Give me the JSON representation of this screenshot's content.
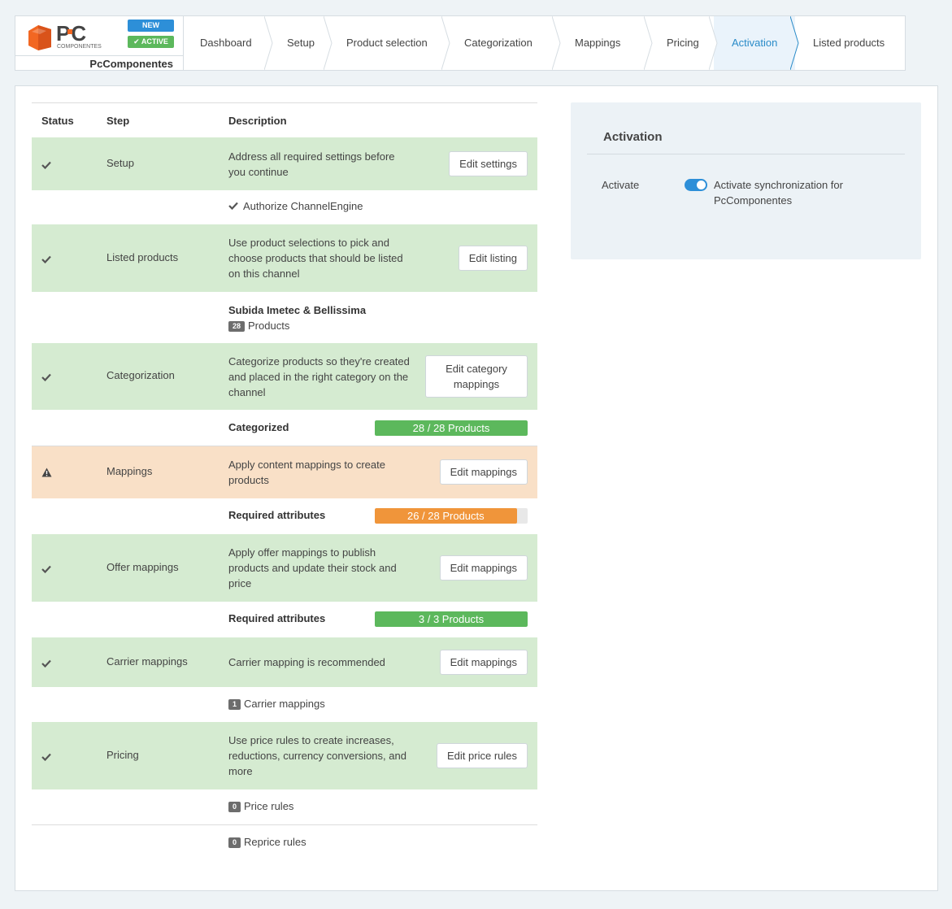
{
  "channel": {
    "name": "PcComponentes",
    "logo_text": "PC",
    "logo_sub": "COMPONENTES",
    "badge_new": "NEW",
    "badge_active": "ACTIVE"
  },
  "nav": {
    "steps": [
      "Dashboard",
      "Setup",
      "Product selection",
      "Categorization",
      "Mappings",
      "Pricing",
      "Activation",
      "Listed products"
    ],
    "active": "Activation"
  },
  "table": {
    "headers": {
      "status": "Status",
      "step": "Step",
      "description": "Description"
    },
    "rows": [
      {
        "status": "ok",
        "step": "Setup",
        "description": "Address all required settings before you continue",
        "button": "Edit settings"
      },
      {
        "sub": "Authorize ChannelEngine"
      },
      {
        "status": "ok",
        "step": "Listed products",
        "description": "Use product selections to pick and choose products that should be listed on this channel",
        "button": "Edit listing"
      },
      {
        "sub_title": "Subida Imetec & Bellissima",
        "count": "28",
        "count_label": "Products"
      },
      {
        "status": "ok",
        "step": "Categorization",
        "description": "Categorize products so they're created and placed in the right category on the channel",
        "button": "Edit category mappings"
      },
      {
        "sub_title": "Categorized",
        "progress_text": "28 / 28 Products",
        "progress": 1.0
      },
      {
        "status": "warning",
        "step": "Mappings",
        "description": "Apply content mappings to create products",
        "button": "Edit mappings"
      },
      {
        "sub_title": "Required attributes",
        "progress_text": "26 / 28 Products",
        "progress": 0.929
      },
      {
        "status": "ok",
        "step": "Offer mappings",
        "description": "Apply offer mappings to publish products and update their stock and price",
        "button": "Edit mappings"
      },
      {
        "sub_title": "Required attributes",
        "progress_text": "3 / 3 Products",
        "progress": 1.0
      },
      {
        "status": "ok",
        "step": "Carrier mappings",
        "description": "Carrier mapping is recommended",
        "button": "Edit mappings"
      },
      {
        "count": "1",
        "count_label": "Carrier mappings"
      },
      {
        "status": "ok",
        "step": "Pricing",
        "description": "Use price rules to create increases, reductions, currency conversions, and more",
        "button": "Edit price rules"
      },
      {
        "count": "0",
        "count_label": "Price rules"
      },
      {
        "count": "0",
        "count_label": "Reprice rules"
      }
    ]
  },
  "activation": {
    "title": "Activation",
    "label": "Activate",
    "toggle_on": true,
    "toggle_text": "Activate synchronization for PcComponentes"
  },
  "colors": {
    "accent": "#2d8fd8",
    "success": "#5cb85c",
    "warning": "#f0953a",
    "row_ok": "#d5ebd1",
    "row_warning": "#f9e0c7"
  }
}
